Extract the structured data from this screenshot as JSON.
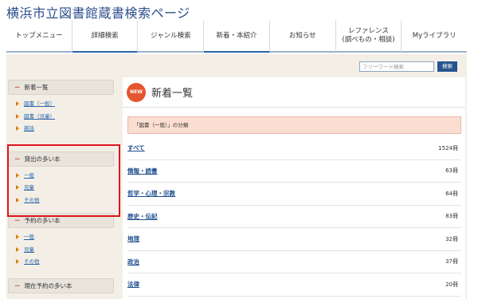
{
  "site": {
    "title": "横浜市立図書館蔵書検索ページ"
  },
  "nav": {
    "items": [
      {
        "label": "トップメニュー"
      },
      {
        "label": "詳細検索"
      },
      {
        "label": "ジャンル検索"
      },
      {
        "label": "新着・本紹介"
      },
      {
        "label": "お知らせ"
      },
      {
        "label": "レファレンス\n(調べもの・相談)"
      },
      {
        "label": "Myライブラリ"
      }
    ]
  },
  "search": {
    "placeholder": "フリーワード検索",
    "button_label": "検索"
  },
  "sidebar": {
    "sections": [
      {
        "title": "新着一覧",
        "items": [
          "図書（一般）",
          "図書（児童）",
          "雑誌"
        ]
      },
      {
        "title": "貸出の多い本",
        "items": [
          "一般",
          "児童",
          "その他"
        ]
      },
      {
        "title": "予約の多い本",
        "items": [
          "一般",
          "児童",
          "その他"
        ]
      },
      {
        "title": "現在予約の多い本",
        "items": []
      }
    ],
    "dash": "－"
  },
  "main": {
    "badge": "NEW",
    "title": "新着一覧",
    "category_label": "「図書（一般）」の分類",
    "rows": [
      {
        "name": "すべて",
        "count": "1524冊"
      },
      {
        "name": "情報・読書",
        "count": "63冊"
      },
      {
        "name": "哲学・心理・宗教",
        "count": "64冊"
      },
      {
        "name": "歴史・伝記",
        "count": "83冊"
      },
      {
        "name": "地理",
        "count": "32冊"
      },
      {
        "name": "政治",
        "count": "37冊"
      },
      {
        "name": "法律",
        "count": "20冊"
      }
    ]
  },
  "colors": {
    "highlight": "#e0141b",
    "accent": "#25548e",
    "category_bg": "#fbded1"
  }
}
